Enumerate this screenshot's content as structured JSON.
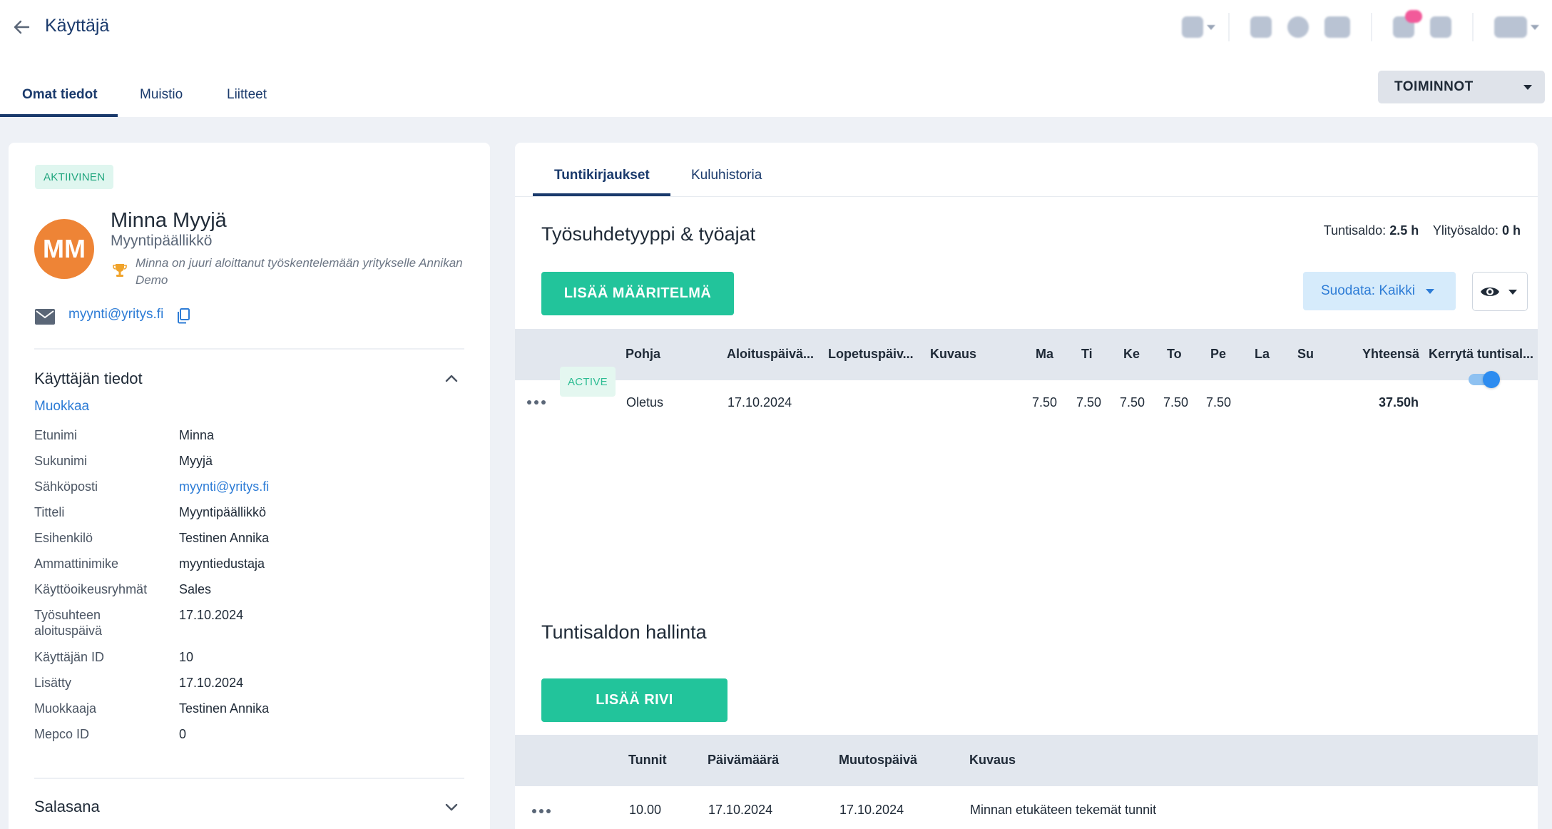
{
  "header": {
    "title": "Käyttäjä",
    "icons": [
      "grid-icon",
      "document-icon",
      "clock-icon",
      "chat-icon",
      "notification-icon",
      "settings-icon",
      "user-menu-icon"
    ]
  },
  "page_tabs": [
    {
      "label": "Omat tiedot",
      "active": true
    },
    {
      "label": "Muistio",
      "active": false
    },
    {
      "label": "Liitteet",
      "active": false
    }
  ],
  "actions_button": "TOIMINNOT",
  "profile": {
    "status": "AKTIIVINEN",
    "initials": "MM",
    "name": "Minna Myyjä",
    "title": "Myyntipäällikkö",
    "note": "Minna on juuri aloittanut työskentelemään yritykselle Annikan Demo",
    "email": "myynti@yritys.fi"
  },
  "user_info": {
    "section_title": "Käyttäjän tiedot",
    "edit_label": "Muokkaa",
    "rows": [
      {
        "label": "Etunimi",
        "value": "Minna"
      },
      {
        "label": "Sukunimi",
        "value": "Myyjä"
      },
      {
        "label": "Sähköposti",
        "value": "myynti@yritys.fi"
      },
      {
        "label": "Titteli",
        "value": "Myyntipäällikkö"
      },
      {
        "label": "Esihenkilö",
        "value": "Testinen Annika"
      },
      {
        "label": "Ammattinimike",
        "value": "myyntiedustaja"
      },
      {
        "label": "Käyttöoikeusryhmät",
        "value": "Sales"
      },
      {
        "label": "Työsuhteen aloituspäivä",
        "value": "17.10.2024"
      },
      {
        "label": "Käyttäjän ID",
        "value": "10"
      },
      {
        "label": "Lisätty",
        "value": "17.10.2024"
      },
      {
        "label": "Muokkaaja",
        "value": "Testinen Annika"
      },
      {
        "label": "Mepco ID",
        "value": "0"
      }
    ]
  },
  "password_section": {
    "title": "Salasana"
  },
  "right_tabs": [
    {
      "label": "Tuntikirjaukset",
      "active": true
    },
    {
      "label": "Kuluhistoria",
      "active": false
    }
  ],
  "work_types": {
    "title": "Työsuhdetyyppi & työajat",
    "saldo_label": "Tuntisaldo:",
    "saldo_value": "2.5 h",
    "overtime_label": "Ylityösaldo:",
    "overtime_value": "0 h",
    "add_button": "LISÄÄ MÄÄRITELMÄ",
    "filter_label": "Suodata: Kaikki",
    "columns": [
      "Pohja",
      "Aloituspäivä...",
      "Lopetuspäiv...",
      "Kuvaus",
      "Ma",
      "Ti",
      "Ke",
      "To",
      "Pe",
      "La",
      "Su",
      "Yhteensä",
      "Kerrytä tuntisal..."
    ],
    "rows": [
      {
        "status": "ACTIVE",
        "pohja": "Oletus",
        "start": "17.10.2024",
        "end": "",
        "desc": "",
        "ma": "7.50",
        "ti": "7.50",
        "ke": "7.50",
        "to": "7.50",
        "pe": "7.50",
        "la": "",
        "su": "",
        "total": "37.50h",
        "accrue": true
      }
    ]
  },
  "balance": {
    "title": "Tuntisaldon hallinta",
    "add_button": "LISÄÄ RIVI",
    "columns": [
      "Tunnit",
      "Päivämäärä",
      "Muutospäivä",
      "Kuvaus"
    ],
    "rows": [
      {
        "hours": "10.00",
        "date": "17.10.2024",
        "changed": "17.10.2024",
        "desc": "Minnan etukäteen tekemät tunnit"
      }
    ]
  }
}
